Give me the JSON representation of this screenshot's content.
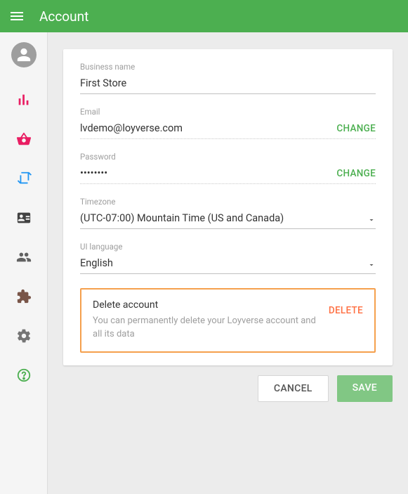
{
  "header": {
    "title": "Account"
  },
  "form": {
    "businessName": {
      "label": "Business name",
      "value": "First Store"
    },
    "email": {
      "label": "Email",
      "value": "lvdemo@loyverse.com",
      "changeLabel": "CHANGE"
    },
    "password": {
      "label": "Password",
      "value": "••••••••",
      "changeLabel": "CHANGE"
    },
    "timezone": {
      "label": "Timezone",
      "value": "(UTC-07:00) Mountain Time (US and Canada)"
    },
    "language": {
      "label": "UI language",
      "value": "English"
    }
  },
  "deleteBox": {
    "title": "Delete account",
    "desc": "You can permanently delete your Loyverse account and all its data",
    "button": "DELETE"
  },
  "actions": {
    "cancel": "CANCEL",
    "save": "SAVE"
  }
}
